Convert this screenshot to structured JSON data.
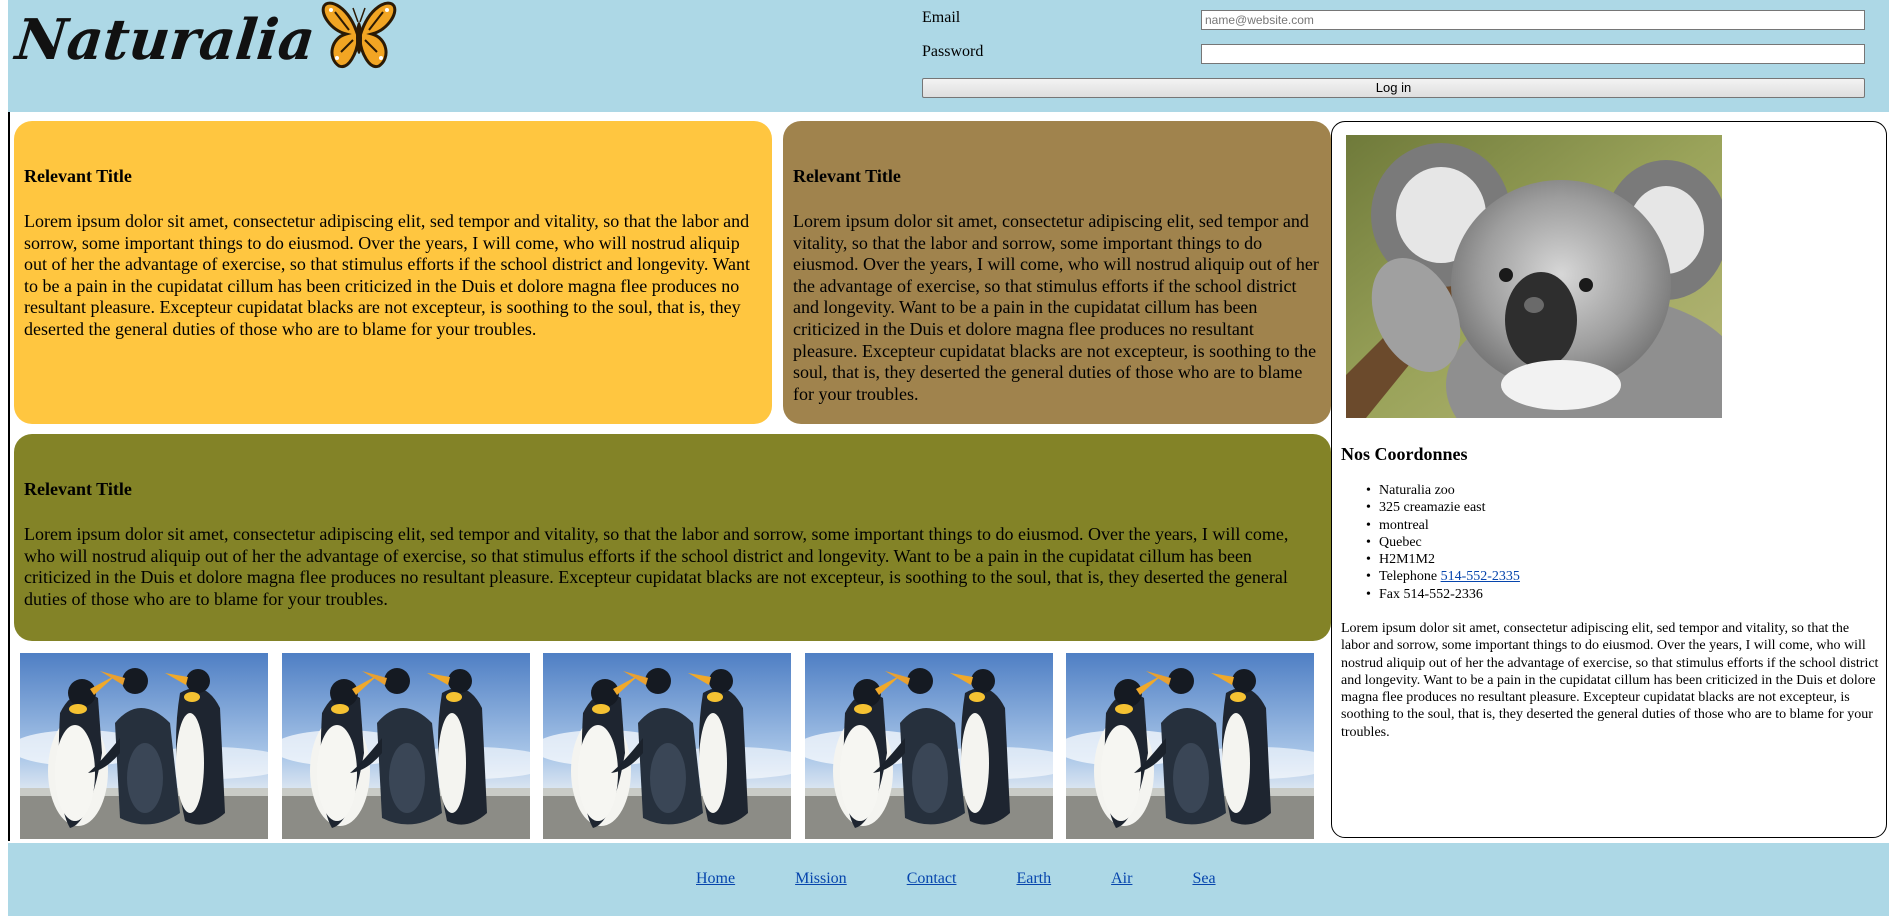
{
  "header": {
    "logo_text": "Naturalia",
    "login": {
      "email_label": "Email",
      "email_placeholder": "name@website.com",
      "password_label": "Password",
      "login_button": "Log in"
    }
  },
  "cards": [
    {
      "title": "Relevant Title",
      "body": "Lorem ipsum dolor sit amet, consectetur adipiscing elit, sed tempor and vitality, so that the labor and sorrow, some important things to do eiusmod. Over the years, I will come, who will nostrud aliquip out of her the advantage of exercise, so that stimulus efforts if the school district and longevity. Want to be a pain in the cupidatat cillum has been criticized in the Duis et dolore magna flee produces no resultant pleasure. Excepteur cupidatat blacks are not excepteur, is soothing to the soul, that is, they deserted the general duties of those who are to blame for your troubles.",
      "color": "#ffc640"
    },
    {
      "title": "Relevant Title",
      "body": "Lorem ipsum dolor sit amet, consectetur adipiscing elit, sed tempor and vitality, so that the labor and sorrow, some important things to do eiusmod. Over the years, I will come, who will nostrud aliquip out of her the advantage of exercise, so that stimulus efforts if the school district and longevity. Want to be a pain in the cupidatat cillum has been criticized in the Duis et dolore magna flee produces no resultant pleasure. Excepteur cupidatat blacks are not excepteur, is soothing to the soul, that is, they deserted the general duties of those who are to blame for your troubles.",
      "color": "#a0834d"
    },
    {
      "title": "Relevant Title",
      "body": "Lorem ipsum dolor sit amet, consectetur adipiscing elit, sed tempor and vitality, so that the labor and sorrow, some important things to do eiusmod. Over the years, I will come, who will nostrud aliquip out of her the advantage of exercise, so that stimulus efforts if the school district and longevity. Want to be a pain in the cupidatat cillum has been criticized in the Duis et dolore magna flee produces no resultant pleasure. Excepteur cupidatat blacks are not excepteur, is soothing to the soul, that is, they deserted the general duties of those who are to blame for your troubles.",
      "color": "#838327"
    }
  ],
  "sidebar": {
    "heading": "Nos Coordonnes",
    "contact": {
      "name": "Naturalia zoo",
      "street": "325 creamazie east",
      "city": "montreal",
      "province": "Quebec",
      "postal": "H2M1M2",
      "phone_label": "Telephone",
      "phone": "514-552-2335",
      "fax": "Fax 514-552-2336"
    },
    "text": "Lorem ipsum dolor sit amet, consectetur adipiscing elit, sed tempor and vitality, so that the labor and sorrow, some important things to do eiusmod. Over the years, I will come, who will nostrud aliquip out of her the advantage of exercise, so that stimulus efforts if the school district and longevity. Want to be a pain in the cupidatat cillum has been criticized in the Duis et dolore magna flee produces no resultant pleasure. Excepteur cupidatat blacks are not excepteur, is soothing to the soul, that is, they deserted the general duties of those who are to blame for your troubles."
  },
  "footer": {
    "links": [
      "Home",
      "Mission",
      "Contact",
      "Earth",
      "Air",
      "Sea"
    ]
  },
  "colors": {
    "header_bg": "#add8e6",
    "link": "#0645ad"
  }
}
